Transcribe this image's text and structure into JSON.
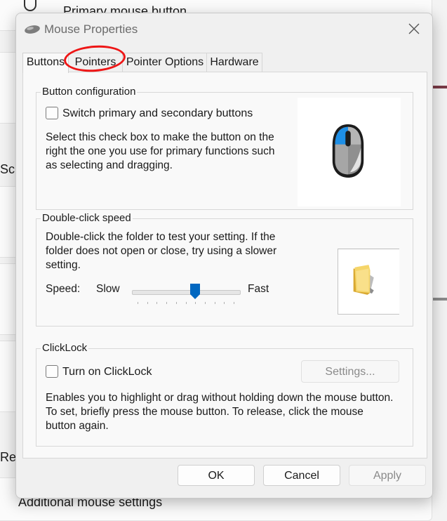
{
  "background": {
    "primary_mouse_button": "Primary mouse button",
    "section_s": "Sc",
    "section_r": "Re",
    "additional_mouse_settings": "Additional mouse settings"
  },
  "dialog": {
    "title": "Mouse Properties",
    "tabs": [
      {
        "label": "Buttons",
        "active": true
      },
      {
        "label": "Pointers",
        "active": false
      },
      {
        "label": "Pointer Options",
        "active": false
      },
      {
        "label": "Hardware",
        "active": false
      }
    ],
    "button_configuration": {
      "group_label": "Button configuration",
      "checkbox_label": "Switch primary and secondary buttons",
      "checked": false,
      "description": "Select this check box to make the button on the right the one you use for primary functions such as selecting and dragging."
    },
    "double_click": {
      "group_label": "Double-click speed",
      "description": "Double-click the folder to test your setting. If the folder does not open or close, try using a slower setting.",
      "speed_label": "Speed:",
      "slow_label": "Slow",
      "fast_label": "Fast",
      "slider_value": 0.6
    },
    "clicklock": {
      "group_label": "ClickLock",
      "checkbox_label": "Turn on ClickLock",
      "checked": false,
      "settings_button": "Settings...",
      "description": "Enables you to highlight or drag without holding down the mouse button. To set, briefly press the mouse button. To release, click the mouse button again."
    },
    "buttons": {
      "ok": "OK",
      "cancel": "Cancel",
      "apply": "Apply"
    }
  },
  "colors": {
    "accent": "#0067c0",
    "annotation": "#ee1616"
  }
}
